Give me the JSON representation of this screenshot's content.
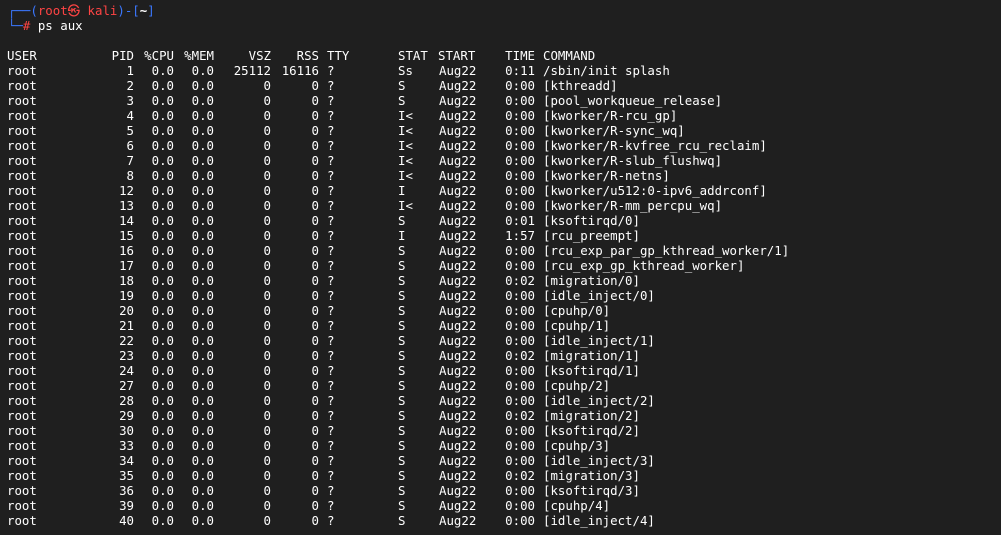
{
  "prompt": {
    "line1_open": "┌──(",
    "user_host": "root㉿ kali",
    "line1_mid": ")-[",
    "cwd": "~",
    "line1_close": "]",
    "line2_prefix": "└─",
    "hash": "#",
    "command": " ps aux"
  },
  "table": {
    "headers": {
      "user": "USER",
      "pid": "PID",
      "cpu": "%CPU",
      "mem": "%MEM",
      "vsz": "VSZ",
      "rss": "RSS",
      "tty": "TTY",
      "stat": "STAT",
      "start": "START",
      "time": "TIME",
      "command": "COMMAND"
    },
    "rows": [
      {
        "user": "root",
        "pid": "1",
        "cpu": "0.0",
        "mem": "0.0",
        "vsz": "25112",
        "rss": "16116",
        "tty": "?",
        "stat": "Ss",
        "start": "Aug22",
        "time": "0:11",
        "command": "/sbin/init splash"
      },
      {
        "user": "root",
        "pid": "2",
        "cpu": "0.0",
        "mem": "0.0",
        "vsz": "0",
        "rss": "0",
        "tty": "?",
        "stat": "S",
        "start": "Aug22",
        "time": "0:00",
        "command": "[kthreadd]"
      },
      {
        "user": "root",
        "pid": "3",
        "cpu": "0.0",
        "mem": "0.0",
        "vsz": "0",
        "rss": "0",
        "tty": "?",
        "stat": "S",
        "start": "Aug22",
        "time": "0:00",
        "command": "[pool_workqueue_release]"
      },
      {
        "user": "root",
        "pid": "4",
        "cpu": "0.0",
        "mem": "0.0",
        "vsz": "0",
        "rss": "0",
        "tty": "?",
        "stat": "I<",
        "start": "Aug22",
        "time": "0:00",
        "command": "[kworker/R-rcu_gp]"
      },
      {
        "user": "root",
        "pid": "5",
        "cpu": "0.0",
        "mem": "0.0",
        "vsz": "0",
        "rss": "0",
        "tty": "?",
        "stat": "I<",
        "start": "Aug22",
        "time": "0:00",
        "command": "[kworker/R-sync_wq]"
      },
      {
        "user": "root",
        "pid": "6",
        "cpu": "0.0",
        "mem": "0.0",
        "vsz": "0",
        "rss": "0",
        "tty": "?",
        "stat": "I<",
        "start": "Aug22",
        "time": "0:00",
        "command": "[kworker/R-kvfree_rcu_reclaim]"
      },
      {
        "user": "root",
        "pid": "7",
        "cpu": "0.0",
        "mem": "0.0",
        "vsz": "0",
        "rss": "0",
        "tty": "?",
        "stat": "I<",
        "start": "Aug22",
        "time": "0:00",
        "command": "[kworker/R-slub_flushwq]"
      },
      {
        "user": "root",
        "pid": "8",
        "cpu": "0.0",
        "mem": "0.0",
        "vsz": "0",
        "rss": "0",
        "tty": "?",
        "stat": "I<",
        "start": "Aug22",
        "time": "0:00",
        "command": "[kworker/R-netns]"
      },
      {
        "user": "root",
        "pid": "12",
        "cpu": "0.0",
        "mem": "0.0",
        "vsz": "0",
        "rss": "0",
        "tty": "?",
        "stat": "I",
        "start": "Aug22",
        "time": "0:00",
        "command": "[kworker/u512:0-ipv6_addrconf]"
      },
      {
        "user": "root",
        "pid": "13",
        "cpu": "0.0",
        "mem": "0.0",
        "vsz": "0",
        "rss": "0",
        "tty": "?",
        "stat": "I<",
        "start": "Aug22",
        "time": "0:00",
        "command": "[kworker/R-mm_percpu_wq]"
      },
      {
        "user": "root",
        "pid": "14",
        "cpu": "0.0",
        "mem": "0.0",
        "vsz": "0",
        "rss": "0",
        "tty": "?",
        "stat": "S",
        "start": "Aug22",
        "time": "0:01",
        "command": "[ksoftirqd/0]"
      },
      {
        "user": "root",
        "pid": "15",
        "cpu": "0.0",
        "mem": "0.0",
        "vsz": "0",
        "rss": "0",
        "tty": "?",
        "stat": "I",
        "start": "Aug22",
        "time": "1:57",
        "command": "[rcu_preempt]"
      },
      {
        "user": "root",
        "pid": "16",
        "cpu": "0.0",
        "mem": "0.0",
        "vsz": "0",
        "rss": "0",
        "tty": "?",
        "stat": "S",
        "start": "Aug22",
        "time": "0:00",
        "command": "[rcu_exp_par_gp_kthread_worker/1]"
      },
      {
        "user": "root",
        "pid": "17",
        "cpu": "0.0",
        "mem": "0.0",
        "vsz": "0",
        "rss": "0",
        "tty": "?",
        "stat": "S",
        "start": "Aug22",
        "time": "0:00",
        "command": "[rcu_exp_gp_kthread_worker]"
      },
      {
        "user": "root",
        "pid": "18",
        "cpu": "0.0",
        "mem": "0.0",
        "vsz": "0",
        "rss": "0",
        "tty": "?",
        "stat": "S",
        "start": "Aug22",
        "time": "0:02",
        "command": "[migration/0]"
      },
      {
        "user": "root",
        "pid": "19",
        "cpu": "0.0",
        "mem": "0.0",
        "vsz": "0",
        "rss": "0",
        "tty": "?",
        "stat": "S",
        "start": "Aug22",
        "time": "0:00",
        "command": "[idle_inject/0]"
      },
      {
        "user": "root",
        "pid": "20",
        "cpu": "0.0",
        "mem": "0.0",
        "vsz": "0",
        "rss": "0",
        "tty": "?",
        "stat": "S",
        "start": "Aug22",
        "time": "0:00",
        "command": "[cpuhp/0]"
      },
      {
        "user": "root",
        "pid": "21",
        "cpu": "0.0",
        "mem": "0.0",
        "vsz": "0",
        "rss": "0",
        "tty": "?",
        "stat": "S",
        "start": "Aug22",
        "time": "0:00",
        "command": "[cpuhp/1]"
      },
      {
        "user": "root",
        "pid": "22",
        "cpu": "0.0",
        "mem": "0.0",
        "vsz": "0",
        "rss": "0",
        "tty": "?",
        "stat": "S",
        "start": "Aug22",
        "time": "0:00",
        "command": "[idle_inject/1]"
      },
      {
        "user": "root",
        "pid": "23",
        "cpu": "0.0",
        "mem": "0.0",
        "vsz": "0",
        "rss": "0",
        "tty": "?",
        "stat": "S",
        "start": "Aug22",
        "time": "0:02",
        "command": "[migration/1]"
      },
      {
        "user": "root",
        "pid": "24",
        "cpu": "0.0",
        "mem": "0.0",
        "vsz": "0",
        "rss": "0",
        "tty": "?",
        "stat": "S",
        "start": "Aug22",
        "time": "0:00",
        "command": "[ksoftirqd/1]"
      },
      {
        "user": "root",
        "pid": "27",
        "cpu": "0.0",
        "mem": "0.0",
        "vsz": "0",
        "rss": "0",
        "tty": "?",
        "stat": "S",
        "start": "Aug22",
        "time": "0:00",
        "command": "[cpuhp/2]"
      },
      {
        "user": "root",
        "pid": "28",
        "cpu": "0.0",
        "mem": "0.0",
        "vsz": "0",
        "rss": "0",
        "tty": "?",
        "stat": "S",
        "start": "Aug22",
        "time": "0:00",
        "command": "[idle_inject/2]"
      },
      {
        "user": "root",
        "pid": "29",
        "cpu": "0.0",
        "mem": "0.0",
        "vsz": "0",
        "rss": "0",
        "tty": "?",
        "stat": "S",
        "start": "Aug22",
        "time": "0:02",
        "command": "[migration/2]"
      },
      {
        "user": "root",
        "pid": "30",
        "cpu": "0.0",
        "mem": "0.0",
        "vsz": "0",
        "rss": "0",
        "tty": "?",
        "stat": "S",
        "start": "Aug22",
        "time": "0:00",
        "command": "[ksoftirqd/2]"
      },
      {
        "user": "root",
        "pid": "33",
        "cpu": "0.0",
        "mem": "0.0",
        "vsz": "0",
        "rss": "0",
        "tty": "?",
        "stat": "S",
        "start": "Aug22",
        "time": "0:00",
        "command": "[cpuhp/3]"
      },
      {
        "user": "root",
        "pid": "34",
        "cpu": "0.0",
        "mem": "0.0",
        "vsz": "0",
        "rss": "0",
        "tty": "?",
        "stat": "S",
        "start": "Aug22",
        "time": "0:00",
        "command": "[idle_inject/3]"
      },
      {
        "user": "root",
        "pid": "35",
        "cpu": "0.0",
        "mem": "0.0",
        "vsz": "0",
        "rss": "0",
        "tty": "?",
        "stat": "S",
        "start": "Aug22",
        "time": "0:02",
        "command": "[migration/3]"
      },
      {
        "user": "root",
        "pid": "36",
        "cpu": "0.0",
        "mem": "0.0",
        "vsz": "0",
        "rss": "0",
        "tty": "?",
        "stat": "S",
        "start": "Aug22",
        "time": "0:00",
        "command": "[ksoftirqd/3]"
      },
      {
        "user": "root",
        "pid": "39",
        "cpu": "0.0",
        "mem": "0.0",
        "vsz": "0",
        "rss": "0",
        "tty": "?",
        "stat": "S",
        "start": "Aug22",
        "time": "0:00",
        "command": "[cpuhp/4]"
      },
      {
        "user": "root",
        "pid": "40",
        "cpu": "0.0",
        "mem": "0.0",
        "vsz": "0",
        "rss": "0",
        "tty": "?",
        "stat": "S",
        "start": "Aug22",
        "time": "0:00",
        "command": "[idle_inject/4]"
      }
    ]
  },
  "colors": {
    "background": "#1f1f1f",
    "prompt_frame": "#3b78ff",
    "prompt_user": "#ff4444",
    "text": "#ffffff"
  }
}
